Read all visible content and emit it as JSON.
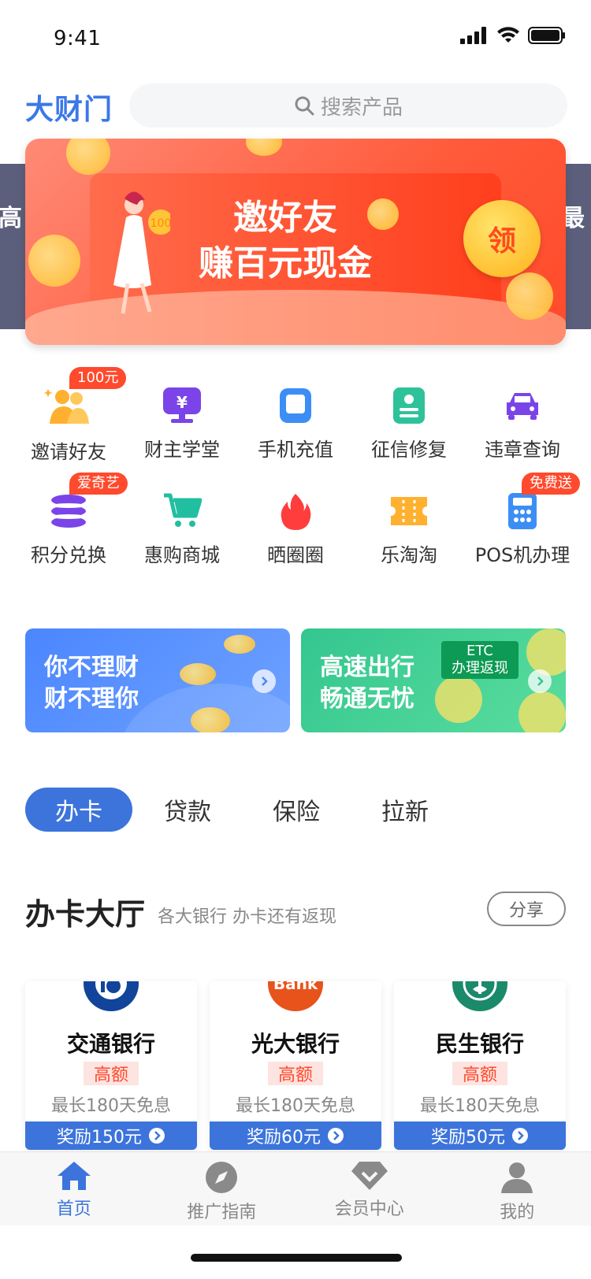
{
  "status": {
    "time": "9:41"
  },
  "header": {
    "brand": "大财门",
    "search_placeholder": "搜索产品"
  },
  "banner": {
    "title_line1": "邀好友",
    "title_line2": "赚百元现金",
    "claim": "领",
    "left_peek_text": "高",
    "right_peek_text": "最"
  },
  "grid": {
    "row1": [
      {
        "label": "邀请好友",
        "icon": "friends-icon",
        "badge": "100元"
      },
      {
        "label": "财主学堂",
        "icon": "yen-monitor-icon"
      },
      {
        "label": "手机充值",
        "icon": "phone-icon"
      },
      {
        "label": "征信修复",
        "icon": "credit-card-icon"
      },
      {
        "label": "违章查询",
        "icon": "car-icon"
      }
    ],
    "row2": [
      {
        "label": "积分兑换",
        "icon": "coins-stack-icon",
        "badge": "爱奇艺"
      },
      {
        "label": "惠购商城",
        "icon": "cart-icon"
      },
      {
        "label": "晒圈圈",
        "icon": "flame-icon"
      },
      {
        "label": "乐淘淘",
        "icon": "ticket-icon"
      },
      {
        "label": "POS机办理",
        "icon": "calculator-icon",
        "badge": "免费送"
      }
    ]
  },
  "promos": [
    {
      "line1": "你不理财",
      "line2": "财不理你"
    },
    {
      "line1": "高速出行",
      "line2": "畅通无忧",
      "tag_line1": "ETC",
      "tag_line2": "办理返现"
    }
  ],
  "tabs": [
    "办卡",
    "贷款",
    "保险",
    "拉新"
  ],
  "section": {
    "title": "办卡大厅",
    "subtitle": "各大银行 办卡还有返现",
    "share": "分享"
  },
  "banks": [
    {
      "name": "交通银行",
      "highlight": "高额",
      "free": "最长180天免息",
      "reward": "奖励150元",
      "color": "#12449b"
    },
    {
      "name": "光大银行",
      "highlight": "高额",
      "free": "最长180天免息",
      "reward": "奖励60元",
      "color": "#e8531c",
      "logo_text": "Bank"
    },
    {
      "name": "民生银行",
      "highlight": "高额",
      "free": "最长180天免息",
      "reward": "奖励50元",
      "color": "#1a8a6a"
    }
  ],
  "tabbar": [
    {
      "label": "首页",
      "icon": "home-icon",
      "active": true
    },
    {
      "label": "推广指南",
      "icon": "compass-icon"
    },
    {
      "label": "会员中心",
      "icon": "diamond-icon"
    },
    {
      "label": "我的",
      "icon": "user-icon"
    }
  ],
  "colors": {
    "accent": "#3c74dc",
    "badge": "#ff4a2d"
  }
}
